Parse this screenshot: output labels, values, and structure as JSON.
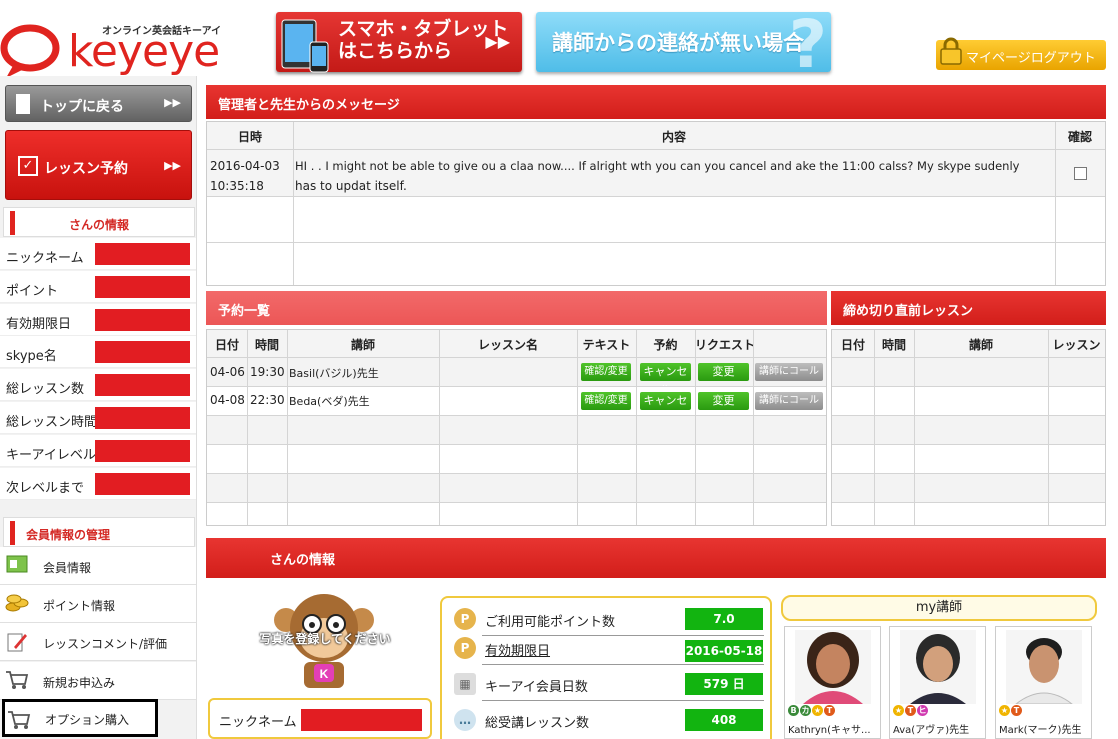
{
  "header": {
    "logo_subtitle": "オンライン英会話キーアイ",
    "logo_text": "keyeye",
    "banner_mobile_line1": "スマホ・タブレット",
    "banner_mobile_line2": "はこちらから",
    "banner_contact": "講師からの連絡が無い場合",
    "logout_label": "マイページログアウト"
  },
  "sidebar": {
    "top_button": "トップに戻る",
    "lesson_button": "レッスン予約",
    "info_heading": "さんの情報",
    "info_rows": [
      {
        "label": "ニックネーム"
      },
      {
        "label": "ポイント"
      },
      {
        "label": "有効期限日"
      },
      {
        "label": "skype名"
      },
      {
        "label": "総レッスン数"
      },
      {
        "label": "総レッスン時間"
      },
      {
        "label": "キーアイレベル"
      },
      {
        "label": "次レベルまで"
      }
    ],
    "manage_heading": "会員情報の管理",
    "menu": [
      {
        "label": "会員情報",
        "icon": "member-card-icon"
      },
      {
        "label": "ポイント情報",
        "icon": "coins-icon"
      },
      {
        "label": "レッスンコメント/評価",
        "icon": "pencil-icon"
      },
      {
        "label": "新規お申込み",
        "icon": "cart-icon"
      },
      {
        "label": "オプション購入",
        "icon": "cart-icon"
      }
    ]
  },
  "messages": {
    "title": "管理者と先生からのメッセージ",
    "col_date": "日時",
    "col_content": "内容",
    "col_confirm": "確認",
    "row_date_line1": "2016-04-03",
    "row_date_line2": "10:35:18",
    "row_text_line1": "HI . . I might not be able to give ou  a claa now.... If alright wth you can you  cancel and ake the 11:00 calss? My skype sudenly",
    "row_text_line2": "has to updat itself."
  },
  "reservations": {
    "title": "予約一覧",
    "headers": {
      "date": "日付",
      "time": "時間",
      "teacher": "講師",
      "lesson": "レッスン名",
      "text": "テキスト",
      "booking": "予約",
      "request": "リクエスト"
    },
    "rows": [
      {
        "date": "04-06",
        "time": "19:30",
        "teacher": "Basil(バジル)先生",
        "text_btn": "確認/変更",
        "cancel_btn": "キャンセル",
        "change_btn": "変更",
        "call_btn": "講師にコール"
      },
      {
        "date": "04-08",
        "time": "22:30",
        "teacher": "Beda(ベダ)先生",
        "text_btn": "確認/変更",
        "cancel_btn": "キャンセル",
        "change_btn": "変更",
        "call_btn": "講師にコール"
      }
    ]
  },
  "deadline": {
    "title": "締め切り直前レッスン",
    "headers": {
      "date": "日付",
      "time": "時間",
      "teacher": "講師",
      "lesson": "レッスン"
    }
  },
  "profile": {
    "title": "さんの情報",
    "photo_caption": "写真を登録してください",
    "nickname_label": "ニックネーム",
    "stats": [
      {
        "label": "ご利用可能ポイント数",
        "value": "7.0",
        "icon": "points-icon"
      },
      {
        "label": "有効期限日",
        "value": "2016-05-18",
        "icon": "points-icon"
      },
      {
        "label": "キーアイ会員日数",
        "value": "579 日",
        "icon": "calendar-icon"
      },
      {
        "label": "総受講レッスン数",
        "value": "408",
        "icon": "chat-icon"
      }
    ],
    "my_teachers_heading": "my講師",
    "teachers": [
      {
        "name": "Kathryn(キャサ..."
      },
      {
        "name": "Ava(アヴァ)先生"
      },
      {
        "name": "Mark(マーク)先生"
      }
    ]
  }
}
